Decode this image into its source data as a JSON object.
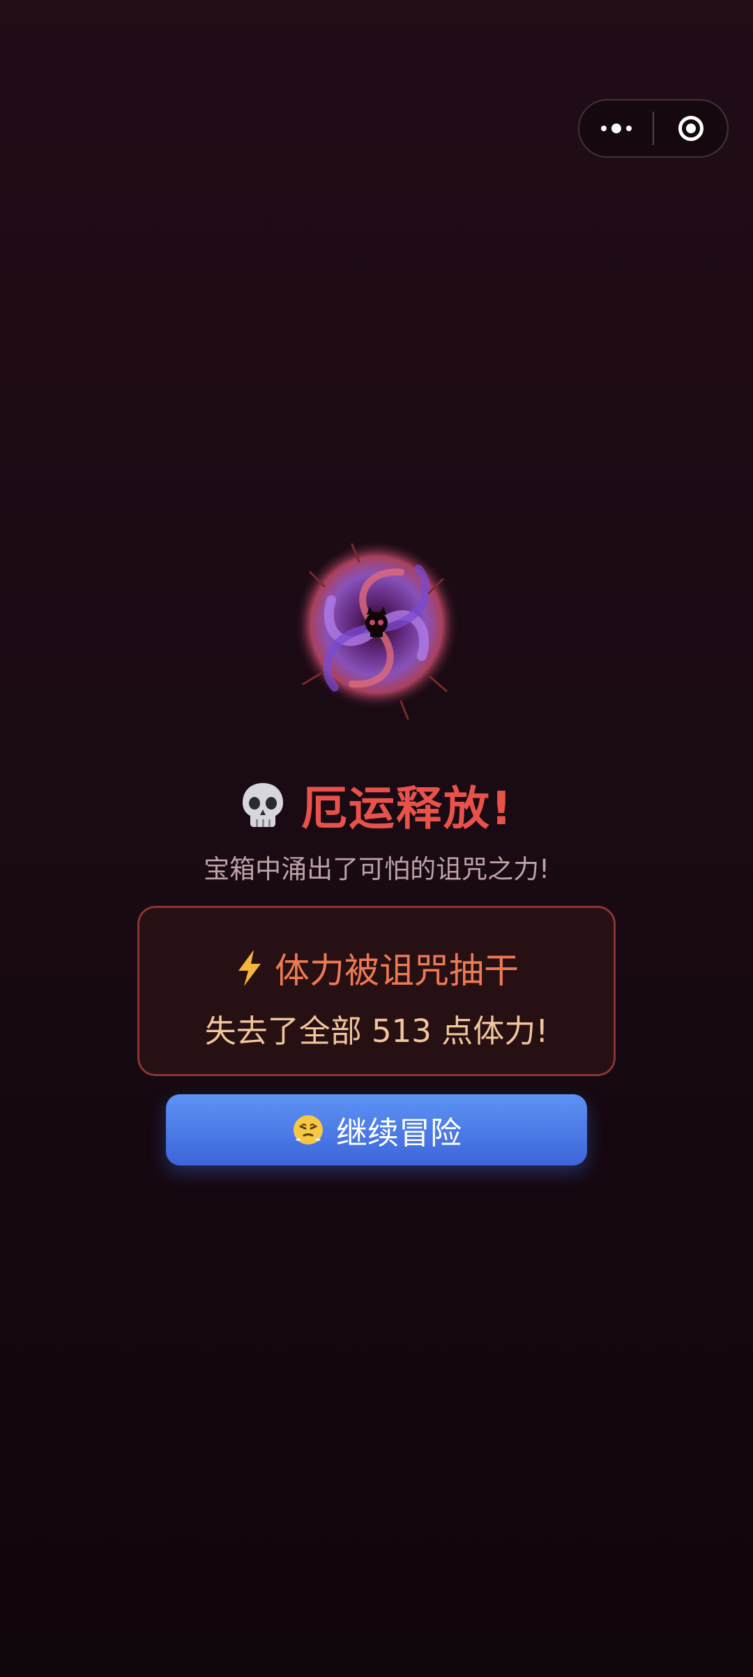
{
  "capsule": {
    "more_icon": "more-dots-icon",
    "close_icon": "target-close-icon"
  },
  "result": {
    "illustration_icon": "curse-vortex-icon",
    "title_icon": "skull-icon",
    "title": "厄运释放!",
    "subtitle": "宝箱中涌出了可怕的诅咒之力!"
  },
  "effect_panel": {
    "icon": "lightning-icon",
    "heading": "体力被诅咒抽干",
    "description": "失去了全部 513 点体力!"
  },
  "continue_button": {
    "icon": "steaming-face-icon",
    "label": "继续冒险"
  },
  "colors": {
    "title": "#e8524a",
    "panel_border": "#8a3432",
    "panel_heading": "#ee7a52",
    "panel_text": "#f0c69a",
    "button": "#4d7ceb"
  }
}
